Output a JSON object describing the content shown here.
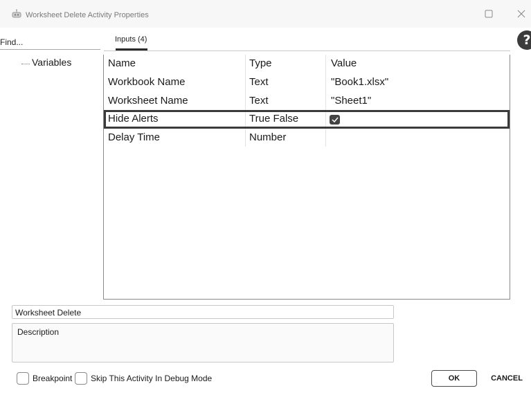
{
  "window": {
    "title": "Worksheet Delete Activity Properties",
    "icons": {
      "app": "robot-icon",
      "maximize": "maximize-icon",
      "close": "close-icon",
      "help": "help-icon"
    },
    "help_glyph": "?"
  },
  "left_panel": {
    "find_label": "Find...",
    "tree": [
      {
        "label": "Variables"
      }
    ]
  },
  "tabs": [
    {
      "label": "Inputs (4)",
      "active": true
    }
  ],
  "grid": {
    "columns": [
      "Name",
      "Type",
      "Value"
    ],
    "rows": [
      {
        "name": "Workbook Name",
        "type": "Text",
        "value": "\"Book1.xlsx\""
      },
      {
        "name": "Worksheet Name",
        "type": "Text",
        "value": "\"Sheet1\""
      },
      {
        "name": "Hide Alerts",
        "type": "True False",
        "checked": true,
        "selected": true
      },
      {
        "name": "Delay Time",
        "type": "Number",
        "value": ""
      }
    ]
  },
  "activity": {
    "name": "Worksheet Delete",
    "description_placeholder": "Description"
  },
  "footer": {
    "breakpoint_label": "Breakpoint",
    "skip_label": "Skip This Activity In Debug Mode",
    "ok_label": "OK",
    "cancel_label": "CANCEL"
  },
  "colors": {
    "selected_row_border": "#3a3a3a",
    "checkbox_fill": "#444444",
    "help_button": "#3b3b3b"
  }
}
